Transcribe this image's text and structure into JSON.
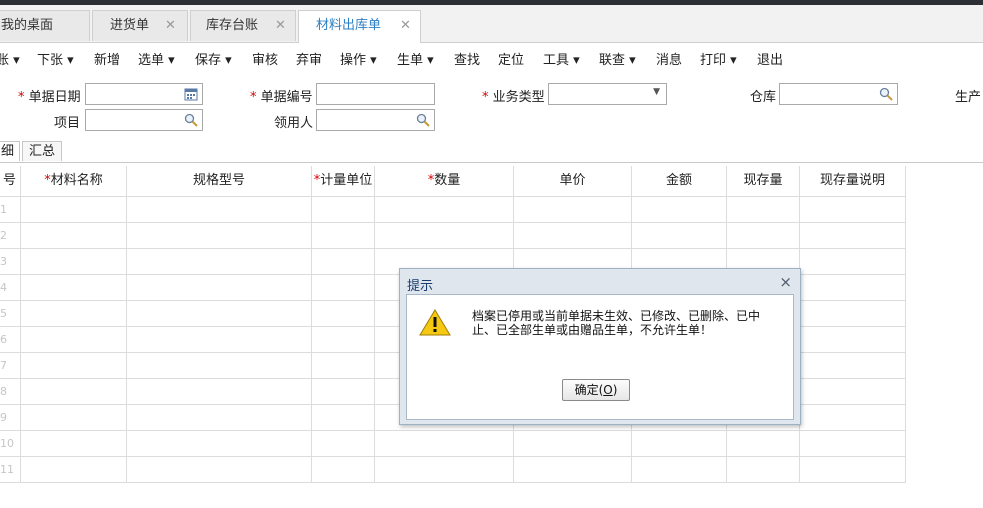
{
  "tabs": [
    {
      "label": "我的桌面",
      "closable": false
    },
    {
      "label": "进货单",
      "closable": true
    },
    {
      "label": "库存台账",
      "closable": true
    },
    {
      "label": "材料出库单",
      "closable": true,
      "active": true
    }
  ],
  "toolbar": [
    "账 ▾",
    "下张 ▾",
    "新增",
    "选单 ▾",
    "保存 ▾",
    "审核",
    "弃审",
    "操作 ▾",
    "生单 ▾",
    "查找",
    "定位",
    "工具 ▾",
    "联查 ▾",
    "消息",
    "打印 ▾",
    "退出"
  ],
  "form": {
    "doc_date": "单据日期",
    "doc_no": "单据编号",
    "biz_type": "业务类型",
    "warehouse": "仓库",
    "production": "生产",
    "project": "项目",
    "receiver": "领用人",
    "required_mark": "*"
  },
  "subtabs": [
    "细",
    "汇总"
  ],
  "grid": {
    "columns": [
      "号",
      "*材料名称",
      "规格型号",
      "*计量单位",
      "*数量",
      "单价",
      "金额",
      "现存量",
      "现存量说明"
    ],
    "row_numbers": [
      "1",
      "2",
      "3",
      "4",
      "5",
      "6",
      "7",
      "8",
      "9",
      "10",
      "11"
    ]
  },
  "dialog": {
    "title": "提示",
    "close": "×",
    "message": "档案已停用或当前单据未生效、已修改、已删除、已中止、已全部生单或由赠品生单，不允许生单！",
    "ok_label": "确定(",
    "ok_key": "O",
    "ok_tail": ")"
  }
}
